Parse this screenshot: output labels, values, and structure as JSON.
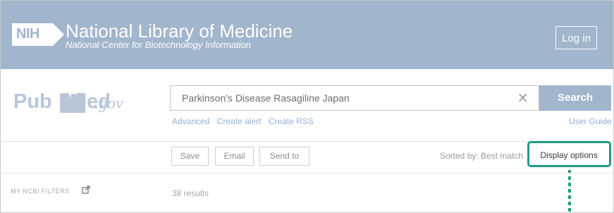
{
  "header": {
    "badge": "NIH",
    "title": "National Library of Medicine",
    "subtitle": "National Center for Biotechnology Information",
    "login_label": "Log in"
  },
  "search": {
    "logo_pub": "Pub",
    "logo_med": "Med",
    "logo_gov": ".gov",
    "query": "Parkinson's Disease Rasagiline Japan",
    "clear_glyph": "×",
    "button_label": "Search",
    "links": [
      "Advanced",
      "Create alert",
      "Create RSS"
    ],
    "user_guide": "User Guide"
  },
  "toolbar": {
    "save": "Save",
    "email": "Email",
    "send_to": "Send to",
    "sorted_by": "Sorted by: Best match",
    "display_options": "Display options"
  },
  "sidebar": {
    "filters_label": "MY NCBI FILTERS"
  },
  "main": {
    "results_count": "38 results"
  },
  "colors": {
    "header_bg": "#a1b5cc",
    "highlight": "#1f9c88",
    "link": "#8fb0d6"
  }
}
